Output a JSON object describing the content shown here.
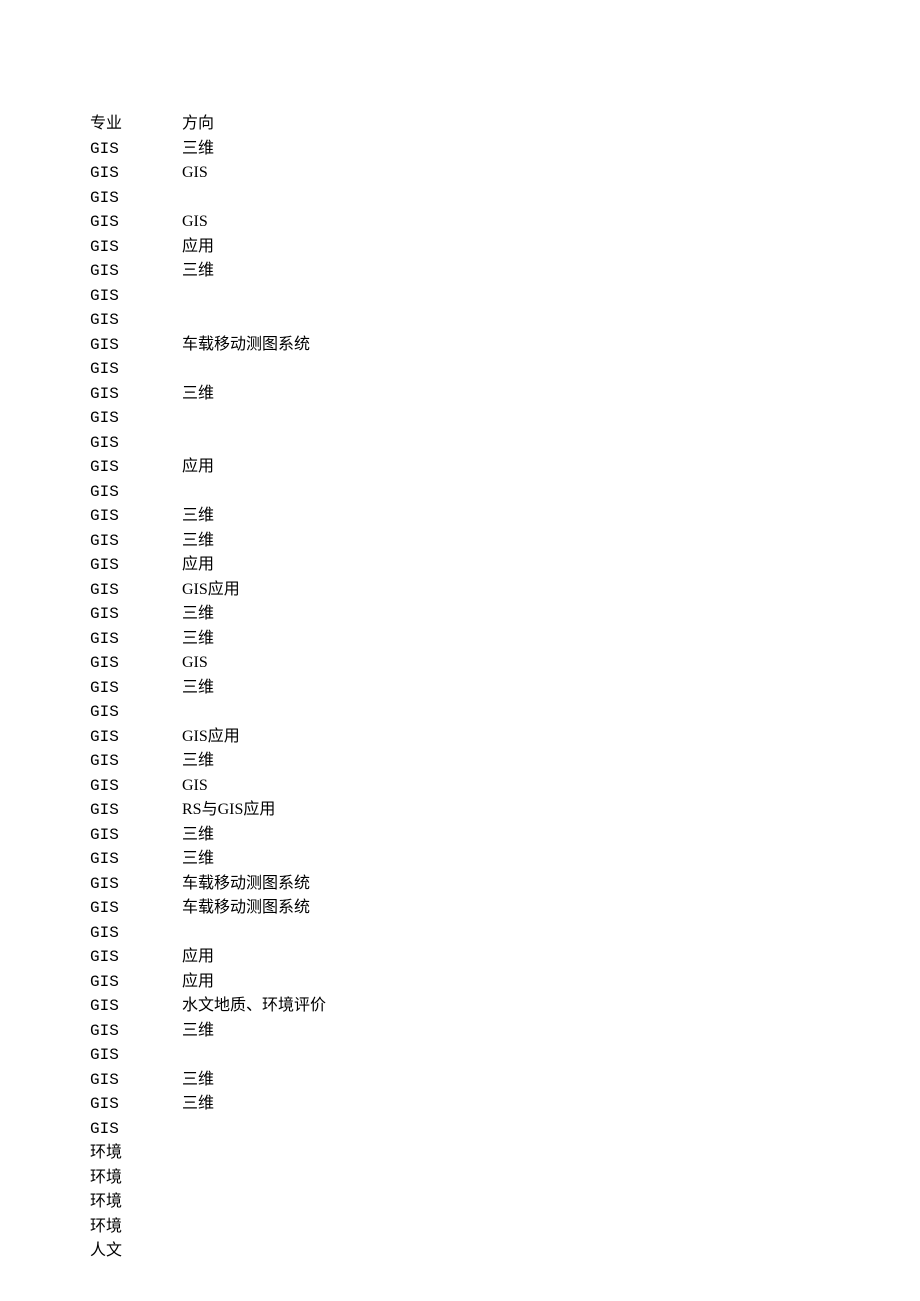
{
  "header": {
    "col1": "专业",
    "col2": "方向"
  },
  "rows": [
    {
      "col1": "GIS",
      "col2": "三维"
    },
    {
      "col1": "GIS",
      "col2": "GIS"
    },
    {
      "col1": "GIS",
      "col2": ""
    },
    {
      "col1": "GIS",
      "col2": "GIS"
    },
    {
      "col1": "GIS",
      "col2": "应用"
    },
    {
      "col1": "GIS",
      "col2": "三维"
    },
    {
      "col1": "GIS",
      "col2": ""
    },
    {
      "col1": "GIS",
      "col2": ""
    },
    {
      "col1": "GIS",
      "col2": "车载移动测图系统"
    },
    {
      "col1": "GIS",
      "col2": ""
    },
    {
      "col1": "GIS",
      "col2": "三维"
    },
    {
      "col1": "GIS",
      "col2": ""
    },
    {
      "col1": "GIS",
      "col2": ""
    },
    {
      "col1": "GIS",
      "col2": "应用"
    },
    {
      "col1": "GIS",
      "col2": ""
    },
    {
      "col1": "GIS",
      "col2": "三维"
    },
    {
      "col1": "GIS",
      "col2": "三维"
    },
    {
      "col1": "GIS",
      "col2": "应用"
    },
    {
      "col1": "GIS",
      "col2": "GIS应用"
    },
    {
      "col1": "GIS",
      "col2": "三维"
    },
    {
      "col1": "GIS",
      "col2": "三维"
    },
    {
      "col1": "GIS",
      "col2": "GIS"
    },
    {
      "col1": "GIS",
      "col2": "三维"
    },
    {
      "col1": "GIS",
      "col2": ""
    },
    {
      "col1": "GIS",
      "col2": "GIS应用"
    },
    {
      "col1": "GIS",
      "col2": "三维"
    },
    {
      "col1": "GIS",
      "col2": "GIS"
    },
    {
      "col1": "GIS",
      "col2": "RS与GIS应用"
    },
    {
      "col1": "GIS",
      "col2": "三维"
    },
    {
      "col1": "GIS",
      "col2": "三维"
    },
    {
      "col1": "GIS",
      "col2": "车载移动测图系统"
    },
    {
      "col1": "GIS",
      "col2": "车载移动测图系统"
    },
    {
      "col1": "GIS",
      "col2": ""
    },
    {
      "col1": "GIS",
      "col2": "应用"
    },
    {
      "col1": "GIS",
      "col2": "应用"
    },
    {
      "col1": "GIS",
      "col2": "水文地质、环境评价"
    },
    {
      "col1": "GIS",
      "col2": "三维"
    },
    {
      "col1": "GIS",
      "col2": ""
    },
    {
      "col1": "GIS",
      "col2": "三维"
    },
    {
      "col1": "GIS",
      "col2": "三维"
    },
    {
      "col1": "GIS",
      "col2": ""
    },
    {
      "col1": "环境",
      "col2": ""
    },
    {
      "col1": "环境",
      "col2": ""
    },
    {
      "col1": "环境",
      "col2": ""
    },
    {
      "col1": "环境",
      "col2": ""
    },
    {
      "col1": "人文",
      "col2": ""
    }
  ]
}
